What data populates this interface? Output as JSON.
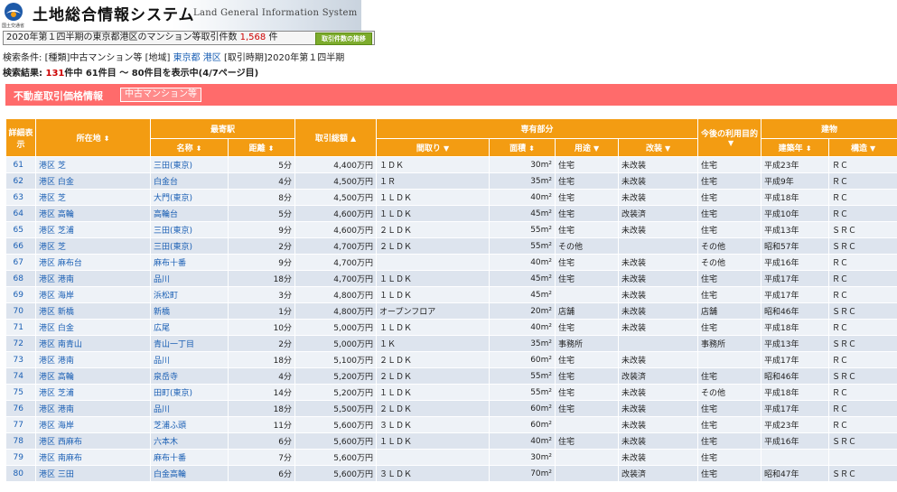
{
  "header": {
    "logo_caption": "国土交通省",
    "title": "土地総合情報システム",
    "subtitle": "Land General Information System"
  },
  "count_bar": {
    "prefix": "2020年第１四半期の東京都港区のマンション等取引件数",
    "count": "1,568",
    "unit": "件",
    "trend_button": "取引件数の推移"
  },
  "search": {
    "label": "検索条件:",
    "kind_label": "[種類]",
    "kind_value": "中古マンション等",
    "area_label": "[地域]",
    "area_pref": "東京都",
    "area_ward": "港区",
    "period_label": "[取引時期]",
    "period_value": "2020年第１四半期"
  },
  "result": {
    "label": "検索結果:",
    "total": "131",
    "text": "件中 61件目 ～ 80件目を表示中(4/7ページ目)"
  },
  "panel": {
    "title": "不動産取引価格情報",
    "tag": "中古マンション等"
  },
  "table": {
    "headers": {
      "detail": "詳細表示",
      "location": "所在地",
      "station_group": "最寄駅",
      "station_name": "名称",
      "distance": "距離",
      "price": "取引総額",
      "private_group": "専有部分",
      "layout": "間取り",
      "area": "面積",
      "use": "用途",
      "renovation": "改装",
      "future_use": "今後の利用目的",
      "building_group": "建物",
      "built_year": "建築年",
      "structure": "構造"
    },
    "sort_icons": {
      "up_down": "⬍",
      "down": "▼",
      "up": "▲"
    },
    "rows": [
      {
        "no": "61",
        "loc": "港区 芝",
        "stn": "三田(東京)",
        "dist": "5分",
        "price": "4,400万円",
        "layout": "１ＤＫ",
        "area": "30m²",
        "use": "住宅",
        "reno": "未改装",
        "future": "住宅",
        "year": "平成23年",
        "struct": "ＲＣ"
      },
      {
        "no": "62",
        "loc": "港区 白金",
        "stn": "白金台",
        "dist": "4分",
        "price": "4,500万円",
        "layout": "１Ｒ",
        "area": "35m²",
        "use": "住宅",
        "reno": "未改装",
        "future": "住宅",
        "year": "平成9年",
        "struct": "ＲＣ"
      },
      {
        "no": "63",
        "loc": "港区 芝",
        "stn": "大門(東京)",
        "dist": "8分",
        "price": "4,500万円",
        "layout": "１ＬＤＫ",
        "area": "40m²",
        "use": "住宅",
        "reno": "未改装",
        "future": "住宅",
        "year": "平成18年",
        "struct": "ＲＣ"
      },
      {
        "no": "64",
        "loc": "港区 高輪",
        "stn": "高輪台",
        "dist": "5分",
        "price": "4,600万円",
        "layout": "１ＬＤＫ",
        "area": "45m²",
        "use": "住宅",
        "reno": "改装済",
        "future": "住宅",
        "year": "平成10年",
        "struct": "ＲＣ"
      },
      {
        "no": "65",
        "loc": "港区 芝浦",
        "stn": "三田(東京)",
        "dist": "9分",
        "price": "4,600万円",
        "layout": "２ＬＤＫ",
        "area": "55m²",
        "use": "住宅",
        "reno": "未改装",
        "future": "住宅",
        "year": "平成13年",
        "struct": "ＳＲＣ"
      },
      {
        "no": "66",
        "loc": "港区 芝",
        "stn": "三田(東京)",
        "dist": "2分",
        "price": "4,700万円",
        "layout": "２ＬＤＫ",
        "area": "55m²",
        "use": "その他",
        "reno": "",
        "future": "その他",
        "year": "昭和57年",
        "struct": "ＳＲＣ"
      },
      {
        "no": "67",
        "loc": "港区 麻布台",
        "stn": "麻布十番",
        "dist": "9分",
        "price": "4,700万円",
        "layout": "",
        "area": "40m²",
        "use": "住宅",
        "reno": "未改装",
        "future": "その他",
        "year": "平成16年",
        "struct": "ＲＣ"
      },
      {
        "no": "68",
        "loc": "港区 港南",
        "stn": "品川",
        "dist": "18分",
        "price": "4,700万円",
        "layout": "１ＬＤＫ",
        "area": "45m²",
        "use": "住宅",
        "reno": "未改装",
        "future": "住宅",
        "year": "平成17年",
        "struct": "ＲＣ"
      },
      {
        "no": "69",
        "loc": "港区 海岸",
        "stn": "浜松町",
        "dist": "3分",
        "price": "4,800万円",
        "layout": "１ＬＤＫ",
        "area": "45m²",
        "use": "",
        "reno": "未改装",
        "future": "住宅",
        "year": "平成17年",
        "struct": "ＲＣ"
      },
      {
        "no": "70",
        "loc": "港区 新橋",
        "stn": "新橋",
        "dist": "1分",
        "price": "4,800万円",
        "layout": "オープンフロア",
        "area": "20m²",
        "use": "店舗",
        "reno": "未改装",
        "future": "店舗",
        "year": "昭和46年",
        "struct": "ＳＲＣ"
      },
      {
        "no": "71",
        "loc": "港区 白金",
        "stn": "広尾",
        "dist": "10分",
        "price": "5,000万円",
        "layout": "１ＬＤＫ",
        "area": "40m²",
        "use": "住宅",
        "reno": "未改装",
        "future": "住宅",
        "year": "平成18年",
        "struct": "ＲＣ"
      },
      {
        "no": "72",
        "loc": "港区 南青山",
        "stn": "青山一丁目",
        "dist": "2分",
        "price": "5,000万円",
        "layout": "１Ｋ",
        "area": "35m²",
        "use": "事務所",
        "reno": "",
        "future": "事務所",
        "year": "平成13年",
        "struct": "ＳＲＣ"
      },
      {
        "no": "73",
        "loc": "港区 港南",
        "stn": "品川",
        "dist": "18分",
        "price": "5,100万円",
        "layout": "２ＬＤＫ",
        "area": "60m²",
        "use": "住宅",
        "reno": "未改装",
        "future": "",
        "year": "平成17年",
        "struct": "ＲＣ"
      },
      {
        "no": "74",
        "loc": "港区 高輪",
        "stn": "泉岳寺",
        "dist": "4分",
        "price": "5,200万円",
        "layout": "２ＬＤＫ",
        "area": "55m²",
        "use": "住宅",
        "reno": "改装済",
        "future": "住宅",
        "year": "昭和46年",
        "struct": "ＳＲＣ"
      },
      {
        "no": "75",
        "loc": "港区 芝浦",
        "stn": "田町(東京)",
        "dist": "14分",
        "price": "5,200万円",
        "layout": "１ＬＤＫ",
        "area": "55m²",
        "use": "住宅",
        "reno": "未改装",
        "future": "その他",
        "year": "平成18年",
        "struct": "ＲＣ"
      },
      {
        "no": "76",
        "loc": "港区 港南",
        "stn": "品川",
        "dist": "18分",
        "price": "5,500万円",
        "layout": "２ＬＤＫ",
        "area": "60m²",
        "use": "住宅",
        "reno": "未改装",
        "future": "住宅",
        "year": "平成17年",
        "struct": "ＲＣ"
      },
      {
        "no": "77",
        "loc": "港区 海岸",
        "stn": "芝浦ふ頭",
        "dist": "11分",
        "price": "5,600万円",
        "layout": "３ＬＤＫ",
        "area": "60m²",
        "use": "",
        "reno": "未改装",
        "future": "住宅",
        "year": "平成23年",
        "struct": "ＲＣ"
      },
      {
        "no": "78",
        "loc": "港区 西麻布",
        "stn": "六本木",
        "dist": "6分",
        "price": "5,600万円",
        "layout": "１ＬＤＫ",
        "area": "40m²",
        "use": "住宅",
        "reno": "未改装",
        "future": "住宅",
        "year": "平成16年",
        "struct": "ＳＲＣ"
      },
      {
        "no": "79",
        "loc": "港区 南麻布",
        "stn": "麻布十番",
        "dist": "7分",
        "price": "5,600万円",
        "layout": "",
        "area": "30m²",
        "use": "",
        "reno": "未改装",
        "future": "住宅",
        "year": "",
        "struct": ""
      },
      {
        "no": "80",
        "loc": "港区 三田",
        "stn": "白金高輪",
        "dist": "6分",
        "price": "5,600万円",
        "layout": "３ＬＤＫ",
        "area": "70m²",
        "use": "",
        "reno": "改装済",
        "future": "住宅",
        "year": "昭和47年",
        "struct": "ＳＲＣ"
      }
    ]
  }
}
